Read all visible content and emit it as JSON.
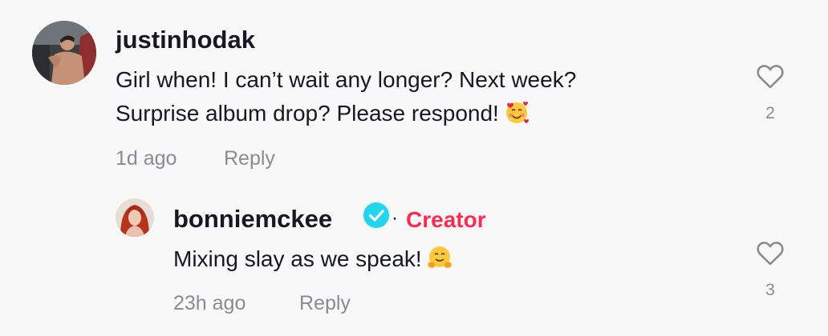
{
  "comments": [
    {
      "username": "justinhodak",
      "text_lines": [
        "Girl when! I can’t wait any longer? Next week?",
        "Surprise album drop? Please respond!"
      ],
      "emoji": "smiling-face-with-hearts",
      "time": "1d ago",
      "reply_label": "Reply",
      "like_count": "2",
      "avatar_icon": "user-avatar"
    },
    {
      "username": "bonniemckee",
      "verified": true,
      "separator": "·",
      "badge": "Creator",
      "text_lines": [
        "Mixing slay as we speak!"
      ],
      "emoji": "hugging-face",
      "time": "23h ago",
      "reply_label": "Reply",
      "like_count": "3",
      "avatar_icon": "user-avatar"
    }
  ],
  "colors": {
    "background": "#f8f8f8",
    "primary_text": "#161823",
    "secondary_text": "#8a8b91",
    "creator_badge": "#fe2c55",
    "verified_badge": "#20d5ec"
  }
}
